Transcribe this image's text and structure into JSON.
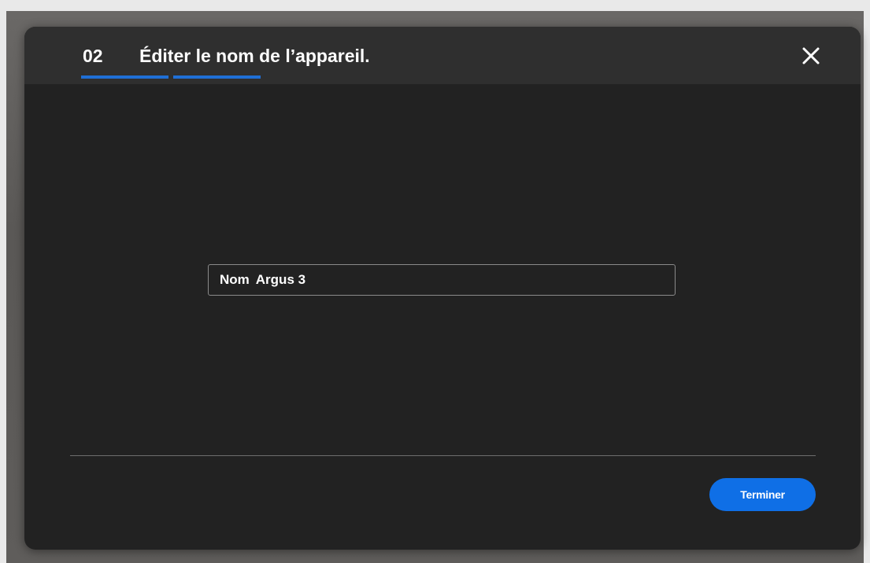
{
  "dialog": {
    "step_number": "02",
    "title": "Éditer le nom de l’appareil.",
    "progress_segments": 2,
    "close_icon": "close-icon",
    "accent_color": "#1f6fd6"
  },
  "name_field": {
    "label": "Nom",
    "value": "Argus 3"
  },
  "footer": {
    "finish_label": "Terminer",
    "button_color": "#0f6fe6"
  }
}
